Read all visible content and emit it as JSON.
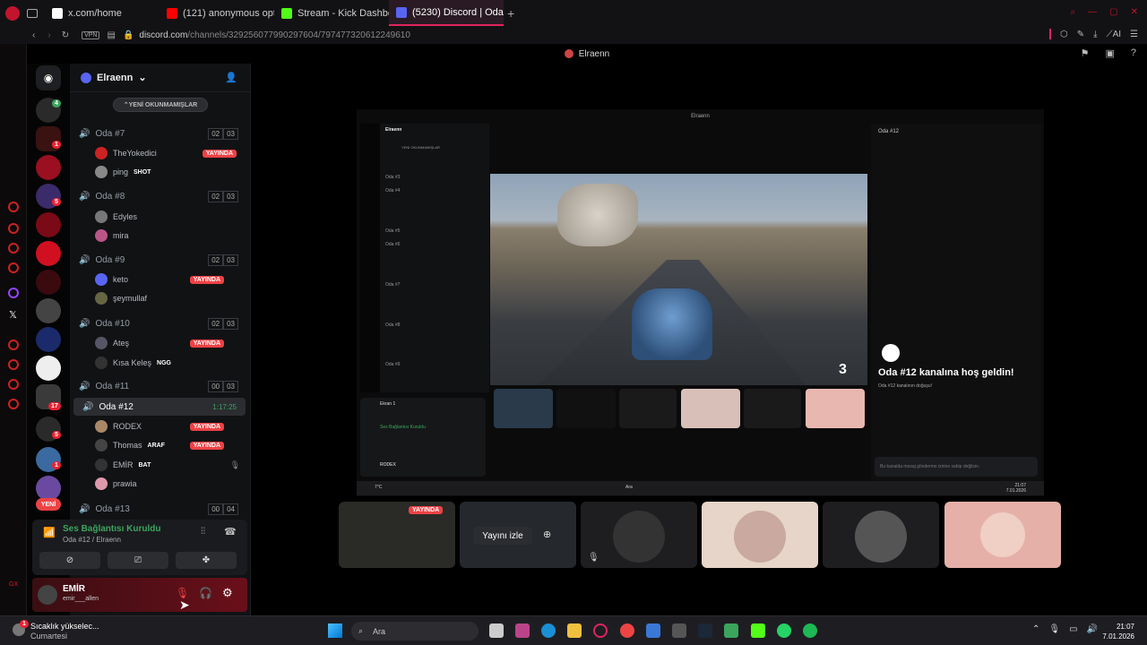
{
  "browser": {
    "tabs": [
      {
        "label": "x.com/home",
        "favicon_color": "#ffffff"
      },
      {
        "label": "(121) anonymous opturkey",
        "favicon_color": "#ff0000"
      },
      {
        "label": "Stream - Kick Dashboard",
        "favicon_color": "#53fc18"
      },
      {
        "label": "(5230) Discord | Oda #12 |",
        "favicon_color": "#5865f2",
        "active": true
      }
    ],
    "vpn_label": "VPN",
    "url_host": "discord.com",
    "url_path": "/channels/329256077990297604/797477320612249610",
    "ai_label": "AI"
  },
  "discord": {
    "window_title": "Elraenn",
    "guild_name": "Elraenn",
    "new_unread_label": "YENİ OKUNMAMIŞLAR",
    "new_label": "YENİ",
    "live_label": "YAYINDA",
    "channels": [
      {
        "name": "Oda #7",
        "count_a": "02",
        "count_b": "03",
        "users": [
          {
            "name": "TheYokedici",
            "live": true
          },
          {
            "name": "ping",
            "tag": "SHOT"
          }
        ]
      },
      {
        "name": "Oda #8",
        "count_a": "02",
        "count_b": "03",
        "users": [
          {
            "name": "Edyles"
          },
          {
            "name": "mira"
          }
        ]
      },
      {
        "name": "Oda #9",
        "count_a": "02",
        "count_b": "03",
        "users": [
          {
            "name": "keto",
            "live": true
          },
          {
            "name": "şeymullaf"
          }
        ]
      },
      {
        "name": "Oda #10",
        "count_a": "02",
        "count_b": "03",
        "users": [
          {
            "name": "Ateş",
            "live": true
          },
          {
            "name": "Kısa Keleş",
            "tag": "NGG"
          }
        ]
      },
      {
        "name": "Oda #11",
        "count_a": "00",
        "count_b": "03",
        "users": []
      },
      {
        "name": "Oda #12",
        "timer": "1:17:25",
        "active": true,
        "users": [
          {
            "name": "RODEX",
            "live": true
          },
          {
            "name": "Thomas",
            "tag": "ARAF",
            "live": true
          },
          {
            "name": "EMİR",
            "tag": "BAT"
          },
          {
            "name": "prawia"
          }
        ]
      },
      {
        "name": "Oda #13",
        "count_a": "00",
        "count_b": "04",
        "users": []
      }
    ],
    "voice_panel": {
      "status": "Ses Bağlantısı Kuruldu",
      "location": "Oda #12 / Elraenn"
    },
    "user_panel": {
      "name": "EMİR",
      "handle": "emir___allen"
    },
    "server_badges": [
      "1",
      "5",
      "17",
      "5",
      "1"
    ]
  },
  "stream": {
    "inner_title": "Elraenn",
    "inner_guild": "Elraenn",
    "inner_new_unread": "YENİ OKUNMAMIŞLAR",
    "inner_channels": [
      "Oda #3",
      "Oda #4",
      "Oda #5",
      "Oda #6",
      "Oda #7",
      "Oda #8",
      "Oda #9"
    ],
    "speed": "3",
    "chat_header": "Oda #12",
    "chat_welcome": "Oda #12 kanalına hoş geldin!",
    "chat_sub": "Oda #12 kanalının doğuşu!",
    "chat_input_placeholder": "Bu kanalda mesaj gönderme iznine sahip değilsin.",
    "inner_voice_status": "Ses Bağlantısı Kuruldu",
    "inner_voice_screen": "Ekran 1",
    "inner_user": "RODEX",
    "inner_taskbar_search": "Ara",
    "inner_clock_time": "21:07",
    "inner_clock_date": "7.01.2026",
    "inner_weather": "7°C"
  },
  "tiles": {
    "watch_label": "Yayını izle",
    "live_label": "YAYINDA"
  },
  "taskbar": {
    "weather_line1": "Sıcaklık yükselec...",
    "weather_line2": "Cumartesi",
    "search_placeholder": "Ara",
    "time": "21:07",
    "date": "7.01.2026",
    "notif_count": "1"
  },
  "colors": {
    "accent": "#e0245e",
    "live": "#ed4245",
    "voice_green": "#3ba55d"
  }
}
